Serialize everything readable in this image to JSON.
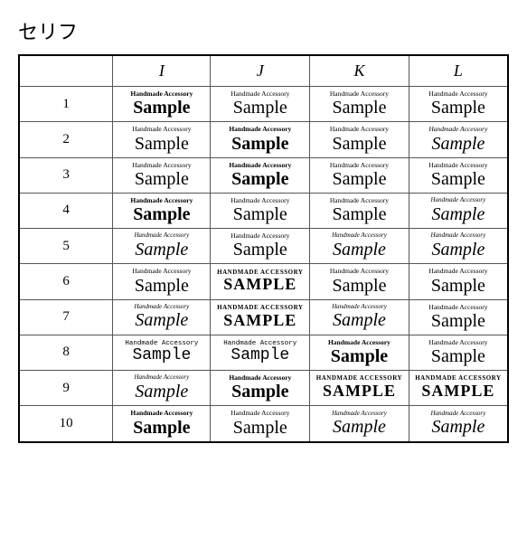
{
  "section": {
    "title": "セリフ"
  },
  "table": {
    "col_headers": [
      "",
      "I",
      "J",
      "K",
      "L"
    ],
    "small_text": "Handmade Accessory",
    "large_text": "Sample",
    "rows": [
      {
        "num": "1"
      },
      {
        "num": "2"
      },
      {
        "num": "3"
      },
      {
        "num": "4"
      },
      {
        "num": "5"
      },
      {
        "num": "6"
      },
      {
        "num": "7"
      },
      {
        "num": "8"
      },
      {
        "num": "9"
      },
      {
        "num": "10"
      }
    ]
  }
}
